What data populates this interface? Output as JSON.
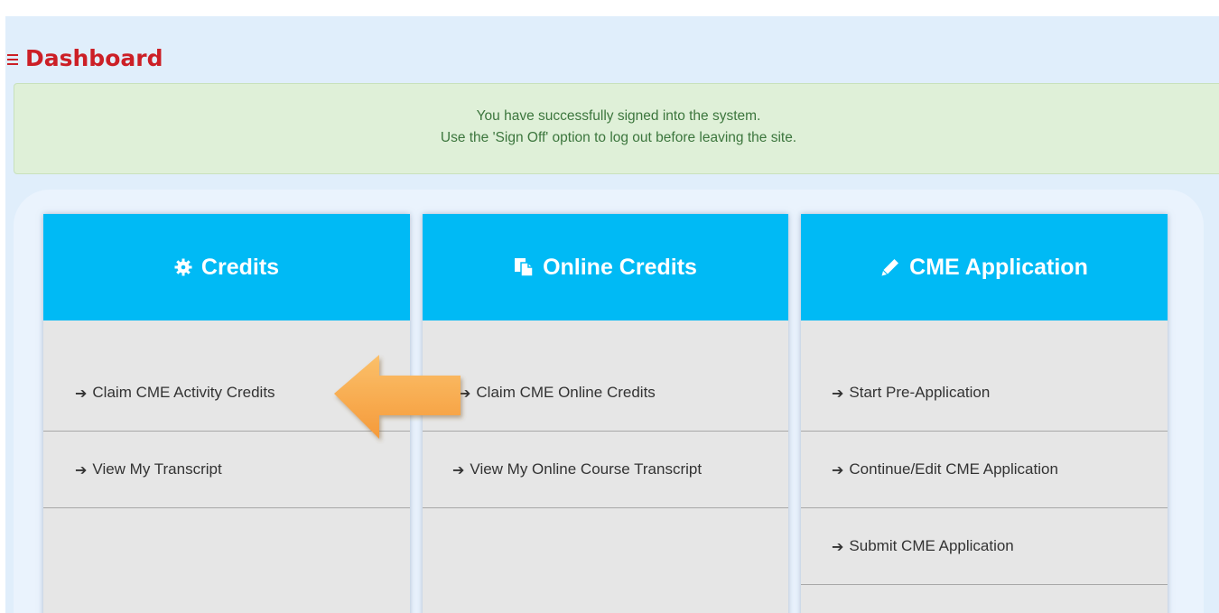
{
  "page": {
    "title": "Dashboard"
  },
  "alert": {
    "line1": "You have successfully signed into the system.",
    "line2": "Use the 'Sign Off' option to log out before leaving the site."
  },
  "cards": {
    "credits": {
      "title": "Credits",
      "icon": "gear-icon",
      "links": {
        "claim": "Claim CME Activity Credits",
        "transcript": "View My Transcript"
      }
    },
    "online": {
      "title": "Online Credits",
      "icon": "documents-icon",
      "links": {
        "claim": "Claim CME Online Credits",
        "transcript": "View My Online Course Transcript"
      }
    },
    "application": {
      "title": "CME Application",
      "icon": "pencil-icon",
      "links": {
        "start": "Start Pre-Application",
        "continue": "Continue/Edit CME Application",
        "submit": "Submit CME Application"
      }
    }
  },
  "colors": {
    "title_red": "#cc1f26",
    "header_blue": "#00baf5",
    "alert_green_bg": "#dff0d8",
    "alert_green_text": "#3c763d",
    "card_bg": "#e6e6e6",
    "pointer_orange": "#f7a94a"
  },
  "annotation": {
    "pointer": "arrow-pointer-icon"
  }
}
